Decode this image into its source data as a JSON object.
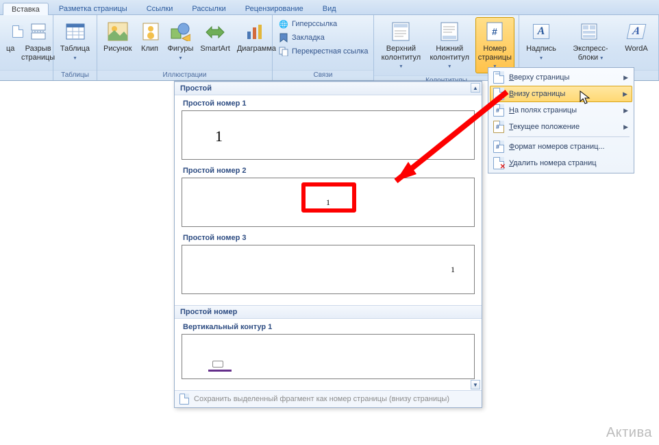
{
  "tabs": {
    "items": [
      "Вставка",
      "Разметка страницы",
      "Ссылки",
      "Рассылки",
      "Рецензирование",
      "Вид"
    ],
    "active": 0
  },
  "ribbon": {
    "groups": {
      "pages": {
        "label": "",
        "items": [
          {
            "label": "ца"
          },
          {
            "label": "Разрыв\nстраницы"
          }
        ]
      },
      "tables": {
        "label": "Таблицы",
        "items": [
          {
            "label": "Таблица"
          }
        ]
      },
      "illus": {
        "label": "Иллюстрации",
        "items": [
          {
            "label": "Рисунок"
          },
          {
            "label": "Клип"
          },
          {
            "label": "Фигуры"
          },
          {
            "label": "SmartArt"
          },
          {
            "label": "Диаграмма"
          }
        ]
      },
      "links": {
        "label": "Связи",
        "items": [
          {
            "label": "Гиперссылка"
          },
          {
            "label": "Закладка"
          },
          {
            "label": "Перекрестная ссылка"
          }
        ]
      },
      "headfoot": {
        "label": "Колонтитулы",
        "items": [
          {
            "label": "Верхний\nколонтитул"
          },
          {
            "label": "Нижний\nколонтитул"
          },
          {
            "label": "Номер\nстраницы"
          }
        ]
      },
      "text": {
        "label": "",
        "items": [
          {
            "label": "Надпись"
          },
          {
            "label": "Экспресс-блоки"
          },
          {
            "label": "WordA"
          }
        ]
      }
    }
  },
  "page_number_menu": {
    "items": [
      {
        "label": "Вверху страницы",
        "sub": true
      },
      {
        "label": "Внизу страницы",
        "sub": true,
        "hl": true
      },
      {
        "label": "На полях страницы",
        "sub": true
      },
      {
        "label": "Текущее положение",
        "sub": true
      },
      {
        "label": "Формат номеров страниц..."
      },
      {
        "label": "Удалить номера страниц"
      }
    ],
    "underline_first": [
      "В",
      "В",
      "Н",
      "Т",
      "Ф",
      "У"
    ]
  },
  "gallery": {
    "sections": [
      {
        "header": "Простой",
        "items": [
          {
            "title": "Простой номер 1",
            "pos": "left",
            "value": "1"
          },
          {
            "title": "Простой номер 2",
            "pos": "center",
            "value": "1"
          },
          {
            "title": "Простой номер 3",
            "pos": "right",
            "value": "1"
          }
        ]
      },
      {
        "header": "Простой номер",
        "items": [
          {
            "title": "Вертикальный контур 1",
            "pos": "vert"
          }
        ]
      }
    ],
    "footer": "Сохранить выделенный фрагмент как номер страницы (внизу страницы)"
  },
  "watermark": "Актива"
}
